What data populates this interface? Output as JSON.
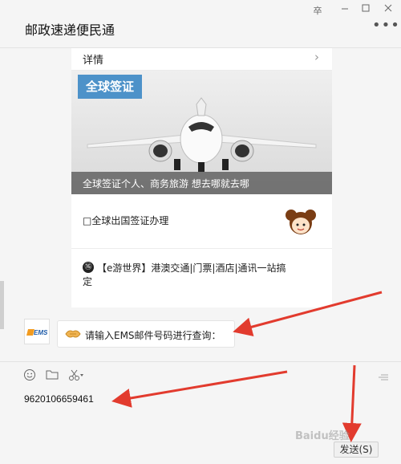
{
  "header": {
    "title": "邮政速递便民通",
    "window_controls": [
      "卒",
      "▭",
      "□",
      "✕"
    ],
    "more": "•••"
  },
  "card": {
    "details_label": "详情",
    "banner_badge": "全球签证",
    "banner_caption": "全球签证个人、商务旅游 想去哪就去哪",
    "item1_text": "□全球出国签证办理",
    "item2_icon": "⑯",
    "item2_text": "【e游世界】港澳交通|门票|酒店|通讯一站搞定"
  },
  "message": {
    "logo_label": "EMS",
    "text": "请输入EMS邮件号码进行查询："
  },
  "input": {
    "value": "9620106659461",
    "send_label": "发送(S)"
  },
  "watermark": "Baidu经验",
  "colors": {
    "badge": "#4d92c9",
    "arrow": "#e23b2e",
    "background": "#f5f5f5"
  }
}
